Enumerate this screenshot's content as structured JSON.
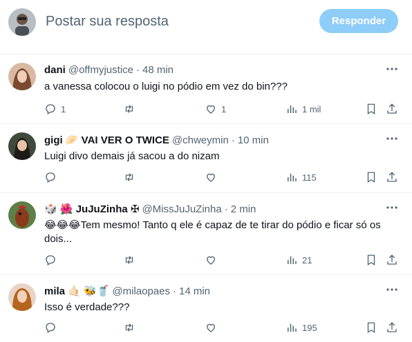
{
  "reply": {
    "placeholder": "Postar sua resposta",
    "button_label": "Responder"
  },
  "tweets": [
    {
      "name": "dani",
      "handle": "@offmyjustice",
      "sep": "·",
      "time": "48 min",
      "text": "a vanessa colocou o luigi no pódio em vez do bin???",
      "replies": "1",
      "retweets": "",
      "likes": "1",
      "views": "1 mil"
    },
    {
      "name": "gigi 🥟 VAI VER O TWICE",
      "handle": "@chweymin",
      "sep": "·",
      "time": "10 min",
      "text": "Luigi divo demais já sacou a do nizam",
      "replies": "",
      "retweets": "",
      "likes": "",
      "views": "115"
    },
    {
      "name": "🎲 🌺 JuJuZinha ✠",
      "handle": "@MissJuJuZinha",
      "sep": "·",
      "time": "2 min",
      "text": "😂😂😂Tem mesmo! Tanto q ele é capaz de te tirar do pódio e ficar só os dois...",
      "replies": "",
      "retweets": "",
      "likes": "",
      "views": "21"
    },
    {
      "name": "mila 🤙🏻 🐝🥤",
      "handle": "@milaopaes",
      "sep": "·",
      "time": "14 min",
      "text": "Isso é verdade???",
      "replies": "",
      "retweets": "",
      "likes": "",
      "views": "195"
    }
  ],
  "colors": {
    "accent_disabled": "#8ecdf8",
    "secondary_text": "#536471",
    "divider": "#eff3f4"
  }
}
